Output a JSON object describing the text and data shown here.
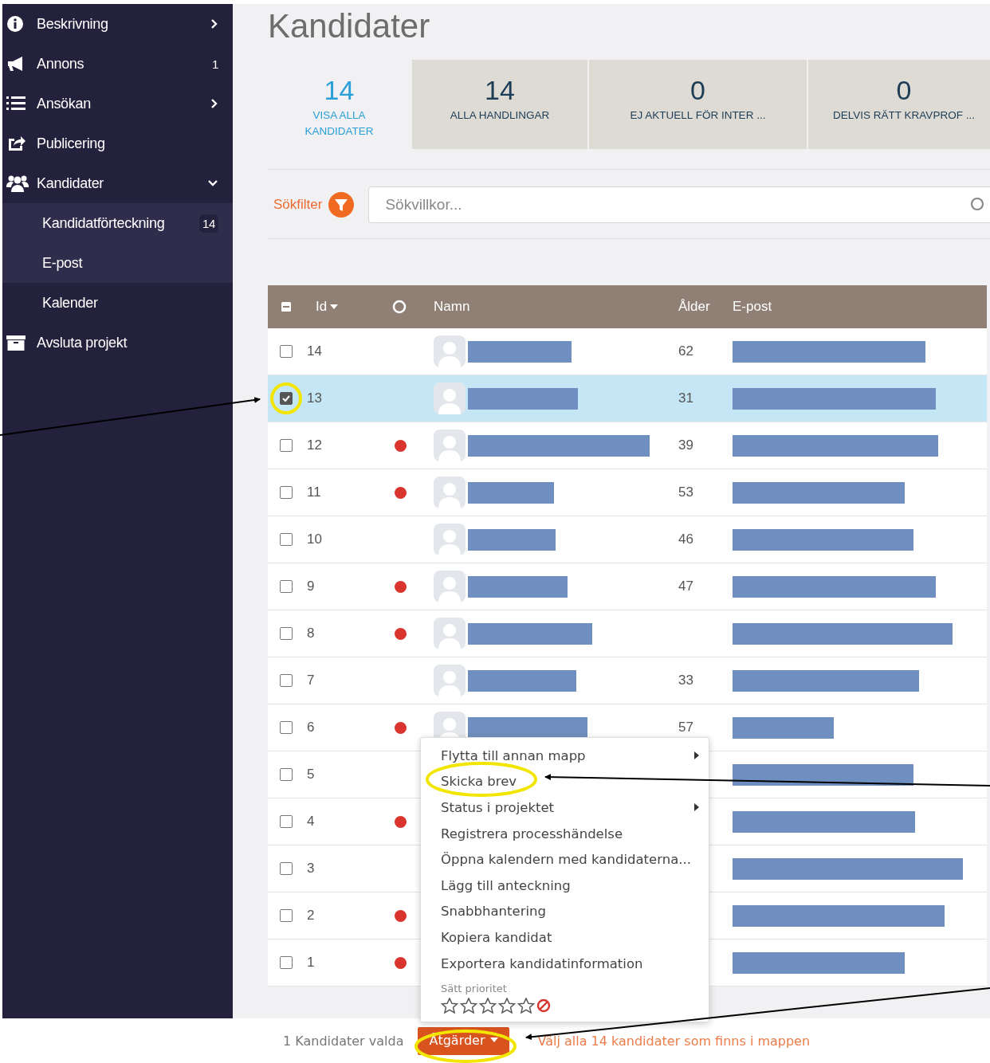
{
  "sidebar": {
    "items": [
      {
        "label": "Beskrivning",
        "expanded": false
      },
      {
        "label": "Annons",
        "count": "1"
      },
      {
        "label": "Ansökan",
        "expanded": false
      },
      {
        "label": "Publicering"
      },
      {
        "label": "Kandidater",
        "expanded": true,
        "children": [
          {
            "label": "Kandidatförteckning",
            "count": "14",
            "selected": true
          },
          {
            "label": "E-post",
            "selected": true
          },
          {
            "label": "Kalender",
            "selected": false
          }
        ]
      },
      {
        "label": "Avsluta projekt"
      }
    ]
  },
  "title": "Kandidater",
  "tabs": [
    {
      "count": "14",
      "label": "VISA ALLA KANDIDATER",
      "selected": true
    },
    {
      "count": "14",
      "label": "ALLA HANDLINGAR",
      "selected": false
    },
    {
      "count": "0",
      "label": "EJ AKTUELL FÖR INTER ...",
      "selected": false
    },
    {
      "count": "0",
      "label": "DELVIS RÄTT KRAVPROF ...",
      "selected": false
    }
  ],
  "search": {
    "filter_label": "Sökfilter",
    "placeholder": "Sökvillkor..."
  },
  "table": {
    "columns": [
      {
        "kind": "select-all",
        "indeterminate": true
      },
      {
        "kind": "sort",
        "label": "Id"
      },
      {
        "kind": "status"
      },
      {
        "kind": "text",
        "label": "Namn"
      },
      {
        "kind": "text",
        "label": "Ålder"
      },
      {
        "kind": "text",
        "label": "E-post"
      }
    ],
    "rows": [
      {
        "id": "14",
        "flagged": false,
        "age": "62",
        "checked": false,
        "selected": false
      },
      {
        "id": "13",
        "flagged": false,
        "age": "31",
        "checked": true,
        "selected": true
      },
      {
        "id": "12",
        "flagged": true,
        "age": "39",
        "checked": false,
        "selected": false
      },
      {
        "id": "11",
        "flagged": true,
        "age": "53",
        "checked": false,
        "selected": false
      },
      {
        "id": "10",
        "flagged": false,
        "age": "46",
        "checked": false,
        "selected": false
      },
      {
        "id": "9",
        "flagged": true,
        "age": "47",
        "checked": false,
        "selected": false
      },
      {
        "id": "8",
        "flagged": true,
        "checked": false,
        "selected": false
      },
      {
        "id": "7",
        "flagged": false,
        "age": "33",
        "checked": false,
        "selected": false
      },
      {
        "id": "6",
        "flagged": true,
        "age": "57",
        "checked": false,
        "selected": false
      },
      {
        "id": "5",
        "flagged": false,
        "checked": false,
        "selected": false
      },
      {
        "id": "4",
        "flagged": true,
        "checked": false,
        "selected": false
      },
      {
        "id": "3",
        "flagged": false,
        "checked": false,
        "selected": false
      },
      {
        "id": "2",
        "flagged": true,
        "checked": false,
        "selected": false
      },
      {
        "id": "1",
        "flagged": true,
        "checked": false,
        "selected": false
      }
    ]
  },
  "context_menu": {
    "items": [
      {
        "label": "Flytta till annan mapp",
        "submenu": true
      },
      {
        "label": "Skicka brev",
        "submenu": false
      },
      {
        "label": "Status i projektet",
        "submenu": true
      },
      {
        "label": "Registrera processhändelse",
        "submenu": false
      },
      {
        "label": "Öppna kalendern med kandidaterna...",
        "submenu": false
      },
      {
        "label": "Lägg till anteckning",
        "submenu": false
      },
      {
        "label": "Snabbhantering",
        "submenu": false
      },
      {
        "label": "Kopiera kandidat",
        "submenu": false
      },
      {
        "label": "Exportera kandidatinformation",
        "submenu": false
      }
    ],
    "priority_label": "Sätt prioritet",
    "stars": 0
  },
  "footer": {
    "selection": "1 Kandidater valda",
    "actions_button": "Åtgärder",
    "select_all_link": "Välj alla 14 kandidater som finns i mappen"
  }
}
